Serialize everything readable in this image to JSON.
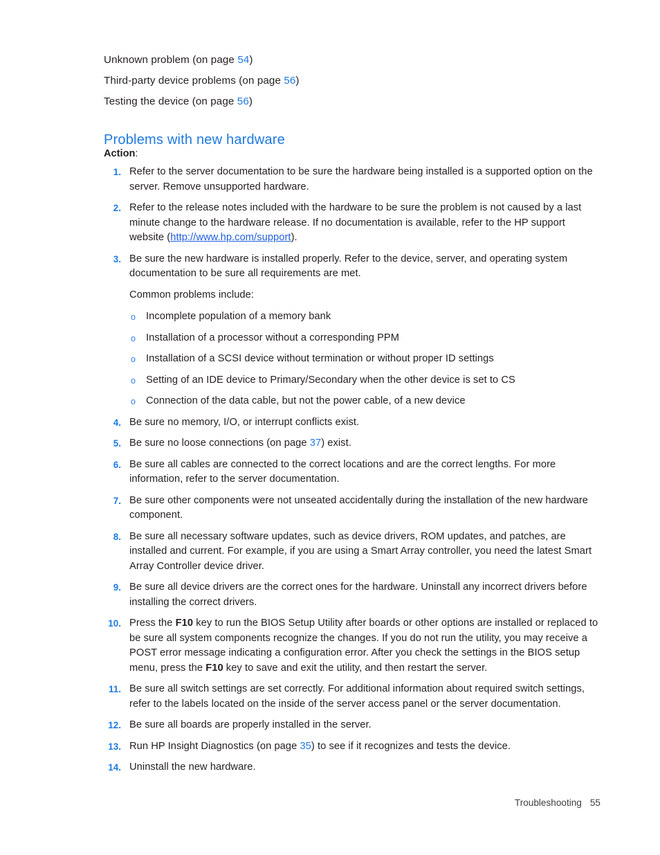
{
  "document": {
    "title": "Problems with new hardware",
    "page_background": "#ffffff",
    "accent_color": "#1f7ae0",
    "text_color": "#231f20"
  },
  "toc": {
    "lines": [
      "Unknown problem (on page 54)",
      "Third-party device problems (on page 56)",
      "Testing the device (on page 56)"
    ],
    "entries": [
      {
        "label": "Unknown problem (on page ",
        "page": "54",
        "suffix": ")"
      },
      {
        "label": "Third-party device problems (on page ",
        "page": "56",
        "suffix": ")"
      },
      {
        "label": "Testing the device (on page ",
        "page": "56",
        "suffix": ")"
      }
    ]
  },
  "heading": "Problems with new hardware",
  "action": {
    "word": "Action",
    "colon": ":"
  },
  "steps": [
    {
      "num": "1.",
      "text": "Refer to the server documentation to be sure the hardware being installed is a supported option on the server. Remove unsupported hardware."
    },
    {
      "num": "2.",
      "part1": "Refer to the release notes included with the hardware to be sure the problem is not caused by a last minute change to the hardware release. If no documentation is available, refer to the HP support website (",
      "link": "http://www.hp.com/support",
      "part2": ")."
    },
    {
      "num": "3.",
      "text": "Be sure the new hardware is installed properly. Refer to the device, server, and operating system documentation to be sure all requirements are met.",
      "extra": "Common problems include:",
      "sublist_marker": "o",
      "sublist": [
        "Incomplete population of a memory bank",
        "Installation of a processor without a corresponding PPM",
        "Installation of a SCSI device without termination or without proper ID settings",
        "Setting of an IDE device to Primary/Secondary when the other device is set to CS",
        "Connection of the data cable, but not the power cable, of a new device"
      ]
    },
    {
      "num": "4.",
      "text": "Be sure no memory, I/O, or interrupt conflicts exist."
    },
    {
      "num": "5.",
      "part1": "Be sure no loose connections (on page ",
      "xref": "37",
      "part2": ") exist."
    },
    {
      "num": "6.",
      "text": "Be sure all cables are connected to the correct locations and are the correct lengths. For more information, refer to the server documentation."
    },
    {
      "num": "7.",
      "text": "Be sure other components were not unseated accidentally during the installation of the new hardware component."
    },
    {
      "num": "8.",
      "text": "Be sure all necessary software updates, such as device drivers, ROM updates, and patches, are installed and current. For example, if you are using a Smart Array controller, you need the latest Smart Array Controller device driver."
    },
    {
      "num": "9.",
      "text": "Be sure all device drivers are the correct ones for the hardware. Uninstall any incorrect drivers before installing the correct drivers."
    },
    {
      "num": "10.",
      "part1": "Press the ",
      "key1": "F10",
      "part2": " key to run the BIOS Setup Utility after boards or other options are installed or replaced to be sure all system components recognize the changes. If you do not run the utility, you may receive a POST error message indicating a configuration error. After you check the settings in the BIOS setup menu, press the ",
      "key2": "F10",
      "part3": " key to save and exit the utility, and then restart the server."
    },
    {
      "num": "11.",
      "text": "Be sure all switch settings are set correctly. For additional information about required switch settings, refer to the labels located on the inside of the server access panel or the server documentation."
    },
    {
      "num": "12.",
      "text": "Be sure all boards are properly installed in the server."
    },
    {
      "num": "13.",
      "part1": "Run HP Insight Diagnostics (on page ",
      "xref": "35",
      "part2": ") to see if it recognizes and tests the device."
    },
    {
      "num": "14.",
      "text": "Uninstall the new hardware."
    }
  ],
  "footer": {
    "chapter": "Troubleshooting",
    "page_number": "55"
  }
}
